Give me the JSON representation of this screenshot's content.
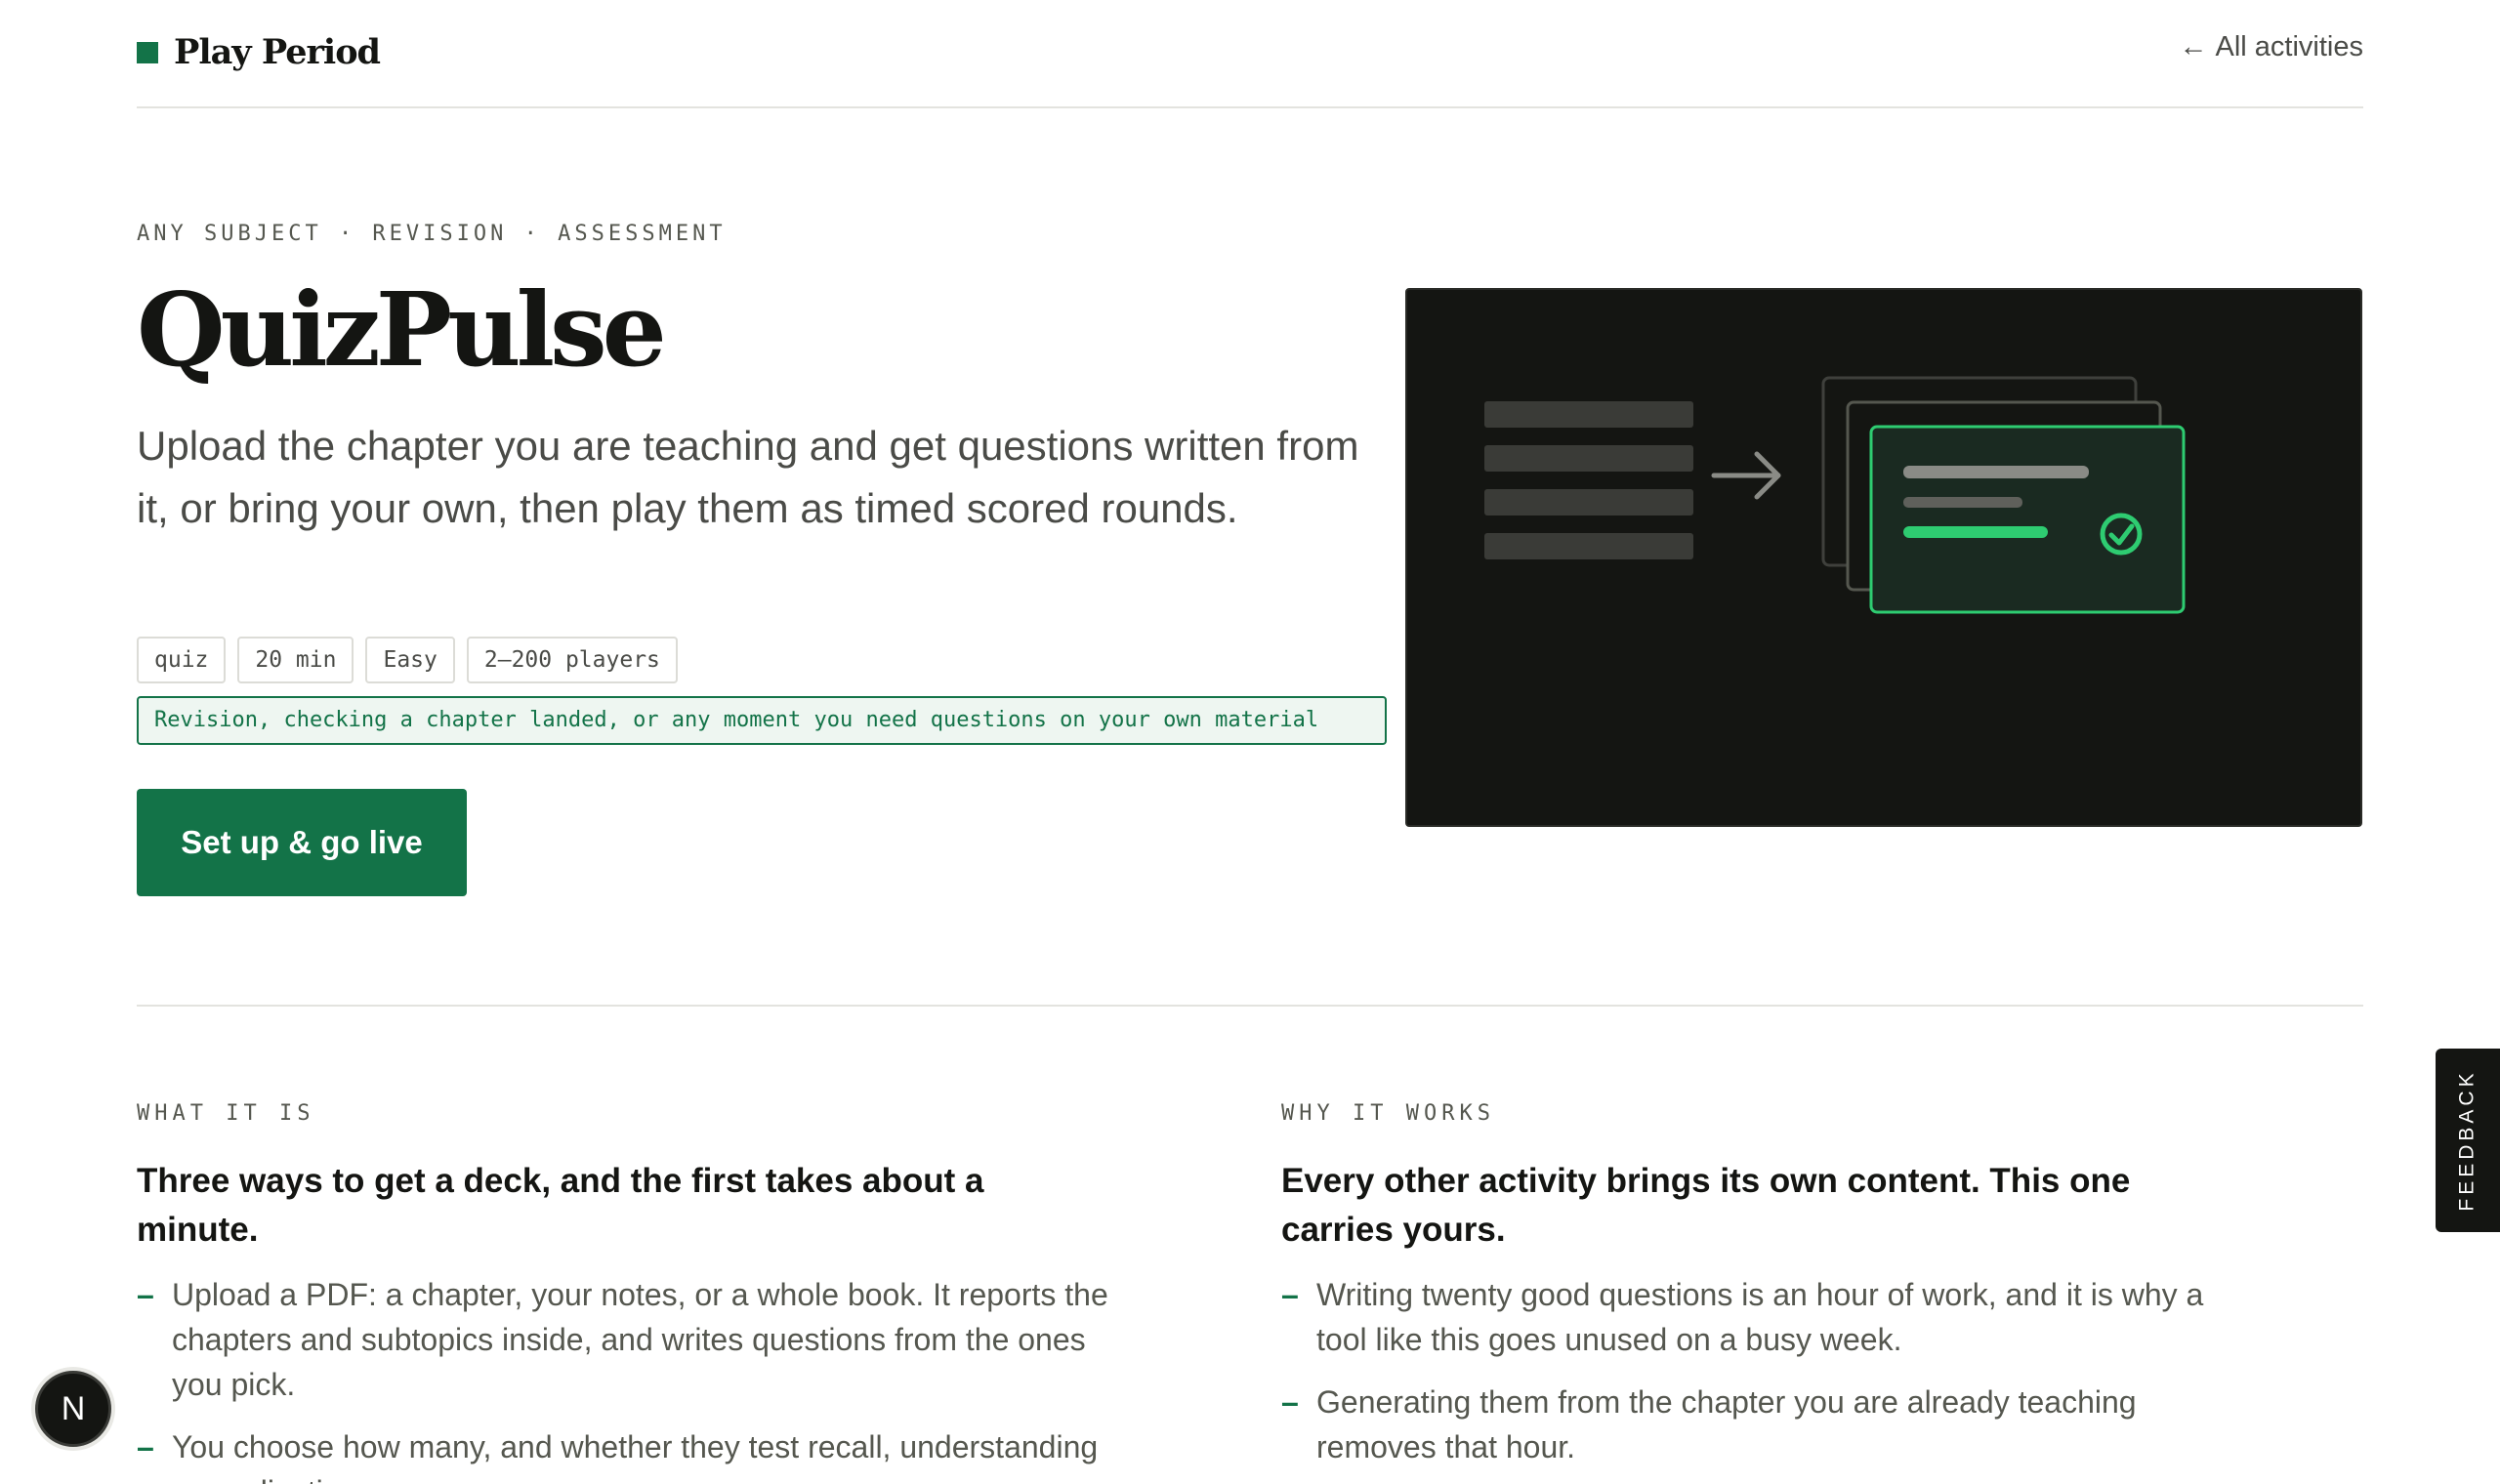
{
  "header": {
    "brand": "Play Period",
    "back_arrow": "←",
    "back_label": "All activities"
  },
  "hero": {
    "eyebrow": "ANY SUBJECT · REVISION · ASSESSMENT",
    "title": "QuizPulse",
    "lede": "Upload the chapter you are teaching and get questions written from it, or bring your own, then play them as timed scored rounds.",
    "chips": [
      "quiz",
      "20 min",
      "Easy",
      "2–200 players"
    ],
    "use_case": "Revision, checking a chapter landed, or any moment you need questions on your own material",
    "cta_label": "Set up & go live"
  },
  "illustration": {
    "icons": [
      "document-lines-icon",
      "arrow-right-icon",
      "question-cards-icon",
      "check-circle-icon"
    ],
    "colors": {
      "background": "#141512",
      "accent": "#2ecc71",
      "muted": "#3a3b37"
    }
  },
  "what_it_is": {
    "label": "WHAT IT IS",
    "heading": "Three ways to get a deck, and the first takes about a minute.",
    "bullets": [
      "Upload a PDF: a chapter, your notes, or a whole book. It reports the chapters and subtopics inside, and writes questions from the ones you pick.",
      "You choose how many, and whether they test recall, understanding or application."
    ]
  },
  "why_it_works": {
    "label": "WHY IT WORKS",
    "heading": "Every other activity brings its own content. This one carries yours.",
    "bullets": [
      "Writing twenty good questions is an hour of work, and it is why a tool like this goes unused on a busy week.",
      "Generating them from the chapter you are already teaching removes that hour."
    ]
  },
  "bullet_marker": "–",
  "feedback_label": "FEEDBACK",
  "n_badge": "N",
  "theme": {
    "accent": "#137348",
    "text": "#141512",
    "muted": "#4a4b47"
  }
}
